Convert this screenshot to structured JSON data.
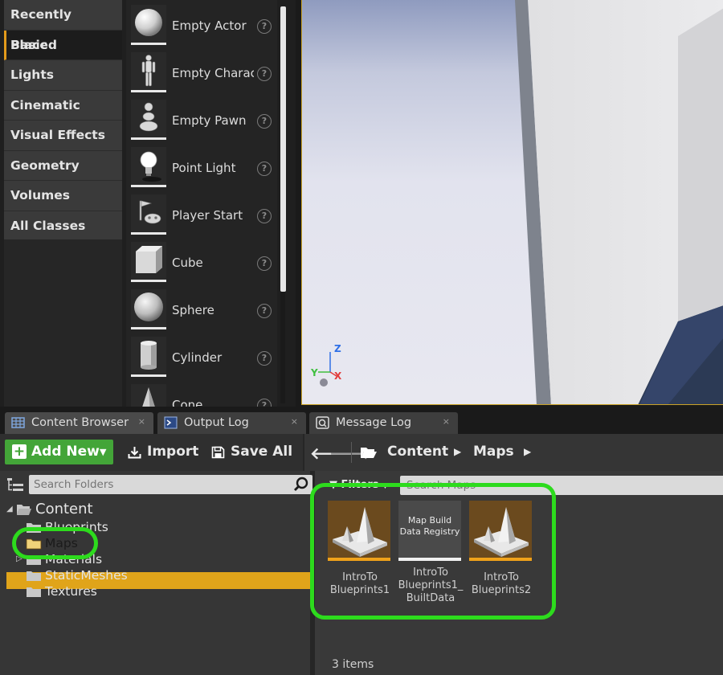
{
  "place_actors": {
    "categories": [
      {
        "label": "Recently Placed"
      },
      {
        "label": "Basic"
      },
      {
        "label": "Lights"
      },
      {
        "label": "Cinematic"
      },
      {
        "label": "Visual Effects"
      },
      {
        "label": "Geometry"
      },
      {
        "label": "Volumes"
      },
      {
        "label": "All Classes"
      }
    ],
    "active_category": "Basic",
    "actors": [
      {
        "label": "Empty Actor",
        "icon": "sphere-icon"
      },
      {
        "label": "Empty Character",
        "icon": "mannequin-icon"
      },
      {
        "label": "Empty Pawn",
        "icon": "pawn-icon"
      },
      {
        "label": "Point Light",
        "icon": "lightbulb-icon"
      },
      {
        "label": "Player Start",
        "icon": "player-start-icon"
      },
      {
        "label": "Cube",
        "icon": "cube-icon"
      },
      {
        "label": "Sphere",
        "icon": "sphere-icon"
      },
      {
        "label": "Cylinder",
        "icon": "cylinder-icon"
      },
      {
        "label": "Cone",
        "icon": "cone-icon"
      }
    ],
    "help_glyph": "?"
  },
  "viewport": {
    "axis_z": "Z",
    "axis_y": "Y",
    "axis_x": "X"
  },
  "tabs": [
    {
      "label": "Content Browser",
      "icon": "content-browser-icon",
      "close": "×"
    },
    {
      "label": "Output Log",
      "icon": "output-log-icon",
      "close": "×"
    },
    {
      "label": "Message Log",
      "icon": "message-log-icon",
      "close": "×"
    }
  ],
  "toolbar": {
    "add_new_label": "Add New",
    "import_label": "Import",
    "save_all_label": "Save All"
  },
  "path": {
    "crumbs": [
      "Content",
      "Maps"
    ]
  },
  "folders": {
    "search_placeholder": "Search Folders",
    "root": "Content",
    "children": [
      "Blueprints",
      "Maps",
      "Materials",
      "StaticMeshes",
      "Textures"
    ],
    "selected": "Maps"
  },
  "assets": {
    "filters_label": "Filters",
    "search_placeholder": "Search Maps",
    "items": [
      {
        "name": "IntroTo Blueprints1",
        "kind": "map"
      },
      {
        "name": "IntroTo Blueprints1_ BuiltData",
        "kind": "registry",
        "thumb_text": "Map Build Data Registry"
      },
      {
        "name": "IntroTo Blueprints2",
        "kind": "map"
      }
    ],
    "count_label": "3 items"
  },
  "colors": {
    "accent": "#e0a41a",
    "add_new_green": "#43a538",
    "highlight_ring": "#2ddb1d"
  }
}
